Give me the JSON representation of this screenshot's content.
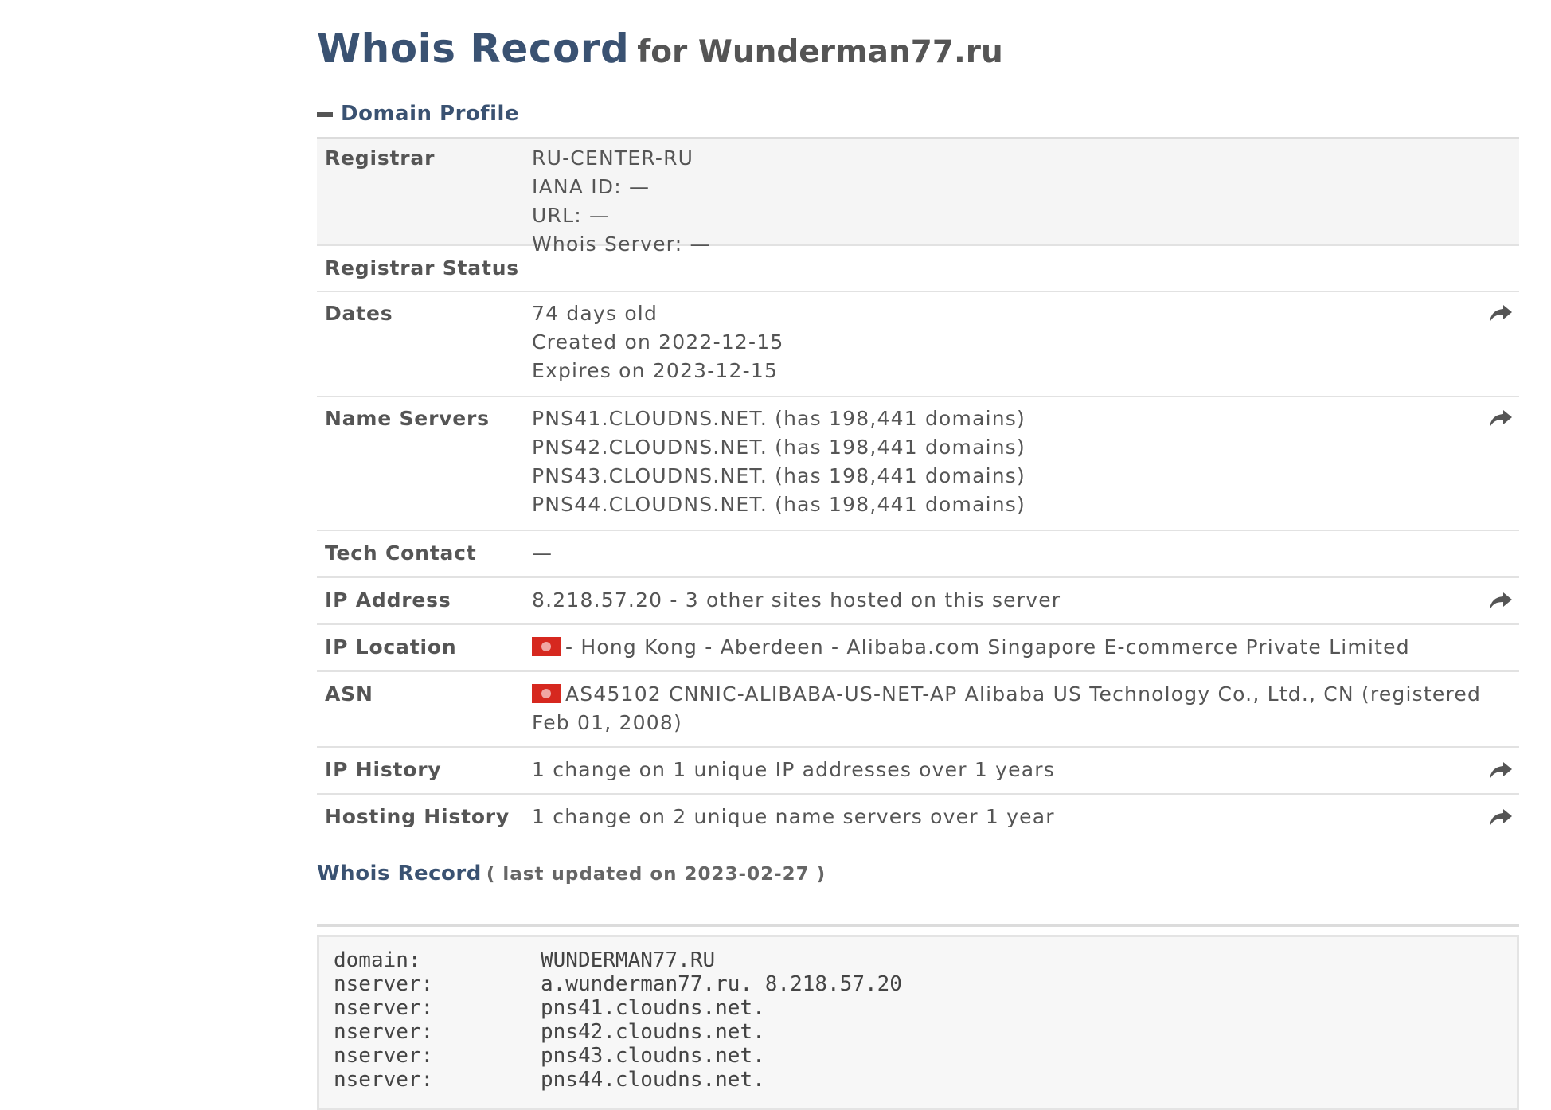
{
  "page": {
    "title": "Whois Record",
    "title_suffix": "for Wunderman77.ru"
  },
  "profile": {
    "section_label": "Domain Profile",
    "rows": {
      "registrar": {
        "label": "Registrar",
        "lines": [
          "RU-CENTER-RU",
          "IANA ID: —",
          "URL: —",
          "Whois Server: —"
        ]
      },
      "registrar_status": {
        "label": "Registrar Status",
        "value": ""
      },
      "dates": {
        "label": "Dates",
        "lines": [
          "74 days old",
          "Created on 2022-12-15",
          "Expires on 2023-12-15"
        ]
      },
      "name_servers": {
        "label": "Name Servers",
        "lines": [
          "PNS41.CLOUDNS.NET. (has 198,441 domains)",
          "PNS42.CLOUDNS.NET. (has 198,441 domains)",
          "PNS43.CLOUDNS.NET. (has 198,441 domains)",
          "PNS44.CLOUDNS.NET. (has 198,441 domains)"
        ]
      },
      "tech_contact": {
        "label": "Tech Contact",
        "value": "—"
      },
      "ip_address": {
        "label": "IP Address",
        "value": "8.218.57.20 - 3 other sites hosted on this server"
      },
      "ip_location": {
        "label": "IP Location",
        "value": "- Hong Kong - Aberdeen - Alibaba.com Singapore E-commerce Private Limited"
      },
      "asn": {
        "label": "ASN",
        "value": "AS45102 CNNIC-ALIBABA-US-NET-AP Alibaba US Technology Co., Ltd., CN (registered Feb 01, 2008)"
      },
      "ip_history": {
        "label": "IP History",
        "value": "1 change on 1 unique IP addresses over 1 years"
      },
      "hosting_history": {
        "label": "Hosting History",
        "value": "1 change on 2 unique name servers over 1 year"
      }
    }
  },
  "whois_record": {
    "title": "Whois Record",
    "updated": "( last updated on 2023-02-27 )",
    "lines": [
      {
        "k": "domain:",
        "v": "WUNDERMAN77.RU"
      },
      {
        "k": "nserver:",
        "v": "a.wunderman77.ru. 8.218.57.20"
      },
      {
        "k": "nserver:",
        "v": "pns41.cloudns.net."
      },
      {
        "k": "nserver:",
        "v": "pns42.cloudns.net."
      },
      {
        "k": "nserver:",
        "v": "pns43.cloudns.net."
      },
      {
        "k": "nserver:",
        "v": "pns44.cloudns.net."
      }
    ]
  },
  "icons": {
    "collapse": "minus-icon",
    "share": "share-arrow-icon",
    "flag": "hong-kong-flag-icon"
  },
  "colors": {
    "heading": "#3a5272",
    "text": "#555555",
    "shaded_row": "#f5f5f5",
    "flag_red": "#d6281f"
  }
}
